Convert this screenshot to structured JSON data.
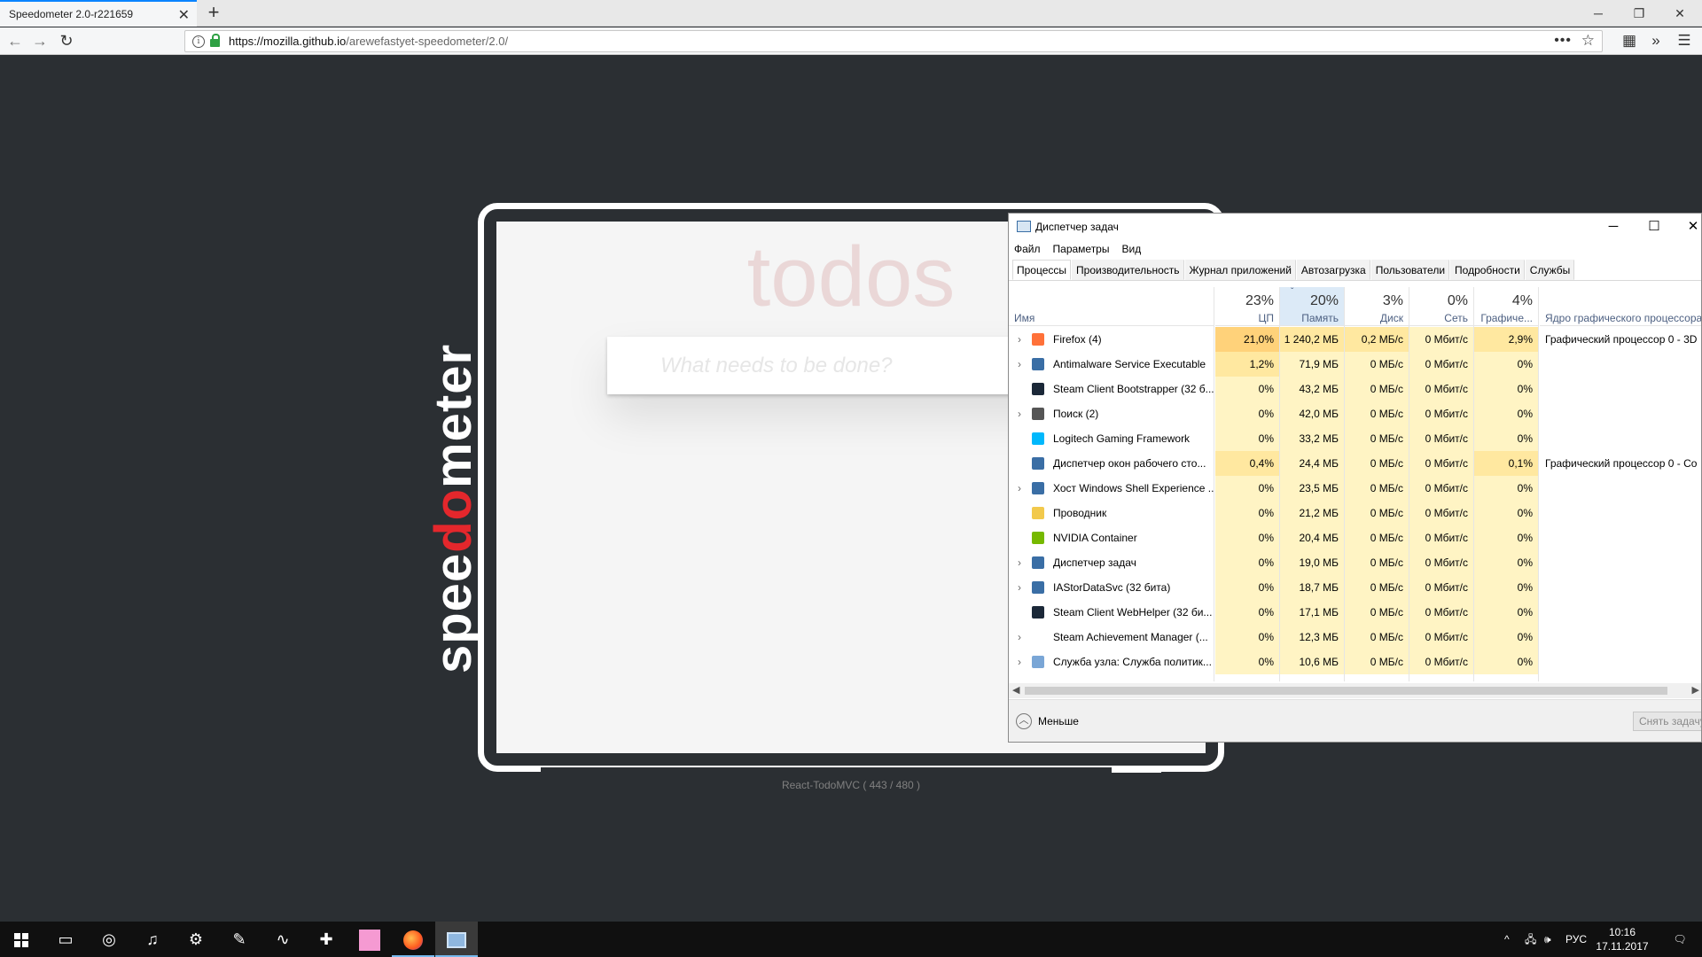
{
  "browser": {
    "tab_title": "Speedometer 2.0-r221659",
    "url_host": "https://mozilla.github.io",
    "url_path": "/arewefastyet-speedometer/2.0/"
  },
  "speedometer": {
    "logo_pre": "spee",
    "logo_mid": "do",
    "logo_post": "meter",
    "todos_title": "todos",
    "todo_placeholder": "What needs to be done?",
    "test_label": "React-TodoMVC ( 443 / 480 )",
    "progress_fraction": 0.92
  },
  "taskmgr": {
    "title": "Диспетчер задач",
    "menu": [
      "Файл",
      "Параметры",
      "Вид"
    ],
    "tabs": [
      "Процессы",
      "Производительность",
      "Журнал приложений",
      "Автозагрузка",
      "Пользователи",
      "Подробности",
      "Службы"
    ],
    "headers": {
      "name": "Имя",
      "cpu_pct": "23%",
      "cpu": "ЦП",
      "mem_pct": "20%",
      "mem": "Память",
      "disk_pct": "3%",
      "disk": "Диск",
      "net_pct": "0%",
      "net": "Сеть",
      "gpu_pct": "4%",
      "gpu": "Графиче...",
      "gpu_engine": "Ядро графического процессора"
    },
    "rows": [
      {
        "name": "Firefox (4)",
        "cpu": "21,0%",
        "mem": "1 240,2 МБ",
        "disk": "0,2 МБ/с",
        "net": "0 Мбит/с",
        "gpu": "2,9%",
        "engine": "Графический процессор 0 - 3D"
      },
      {
        "name": "Antimalware Service Executable",
        "cpu": "1,2%",
        "mem": "71,9 МБ",
        "disk": "0 МБ/с",
        "net": "0 Мбит/с",
        "gpu": "0%",
        "engine": ""
      },
      {
        "name": "Steam Client Bootstrapper (32 б...",
        "cpu": "0%",
        "mem": "43,2 МБ",
        "disk": "0 МБ/с",
        "net": "0 Мбит/с",
        "gpu": "0%",
        "engine": ""
      },
      {
        "name": "Поиск (2)",
        "cpu": "0%",
        "mem": "42,0 МБ",
        "disk": "0 МБ/с",
        "net": "0 Мбит/с",
        "gpu": "0%",
        "engine": ""
      },
      {
        "name": "Logitech Gaming Framework",
        "cpu": "0%",
        "mem": "33,2 МБ",
        "disk": "0 МБ/с",
        "net": "0 Мбит/с",
        "gpu": "0%",
        "engine": ""
      },
      {
        "name": "Диспетчер окон рабочего сто...",
        "cpu": "0,4%",
        "mem": "24,4 МБ",
        "disk": "0 МБ/с",
        "net": "0 Мбит/с",
        "gpu": "0,1%",
        "engine": "Графический процессор 0 - Co"
      },
      {
        "name": "Хост Windows Shell Experience ...",
        "cpu": "0%",
        "mem": "23,5 МБ",
        "disk": "0 МБ/с",
        "net": "0 Мбит/с",
        "gpu": "0%",
        "engine": ""
      },
      {
        "name": "Проводник",
        "cpu": "0%",
        "mem": "21,2 МБ",
        "disk": "0 МБ/с",
        "net": "0 Мбит/с",
        "gpu": "0%",
        "engine": ""
      },
      {
        "name": "NVIDIA Container",
        "cpu": "0%",
        "mem": "20,4 МБ",
        "disk": "0 МБ/с",
        "net": "0 Мбит/с",
        "gpu": "0%",
        "engine": ""
      },
      {
        "name": "Диспетчер задач",
        "cpu": "0%",
        "mem": "19,0 МБ",
        "disk": "0 МБ/с",
        "net": "0 Мбит/с",
        "gpu": "0%",
        "engine": ""
      },
      {
        "name": "IAStorDataSvc (32 бита)",
        "cpu": "0%",
        "mem": "18,7 МБ",
        "disk": "0 МБ/с",
        "net": "0 Мбит/с",
        "gpu": "0%",
        "engine": ""
      },
      {
        "name": "Steam Client WebHelper (32 би...",
        "cpu": "0%",
        "mem": "17,1 МБ",
        "disk": "0 МБ/с",
        "net": "0 Мбит/с",
        "gpu": "0%",
        "engine": ""
      },
      {
        "name": "Steam Achievement Manager (...",
        "cpu": "0%",
        "mem": "12,3 МБ",
        "disk": "0 МБ/с",
        "net": "0 Мбит/с",
        "gpu": "0%",
        "engine": ""
      },
      {
        "name": "Служба узла: Служба политик...",
        "cpu": "0%",
        "mem": "10,6 МБ",
        "disk": "0 МБ/с",
        "net": "0 Мбит/с",
        "gpu": "0%",
        "engine": ""
      }
    ],
    "less_label": "Меньше",
    "end_task_label": "Снять задачу"
  },
  "taskbar": {
    "lang": "РУС",
    "time": "10:16",
    "date": "17.11.2017"
  },
  "colors": {
    "accent": "#0a84ff",
    "speedometer_red": "#e4272c",
    "page_bg": "#2b2f33",
    "heat_high": "#ffd27a",
    "heat_low": "#fff4c4"
  }
}
